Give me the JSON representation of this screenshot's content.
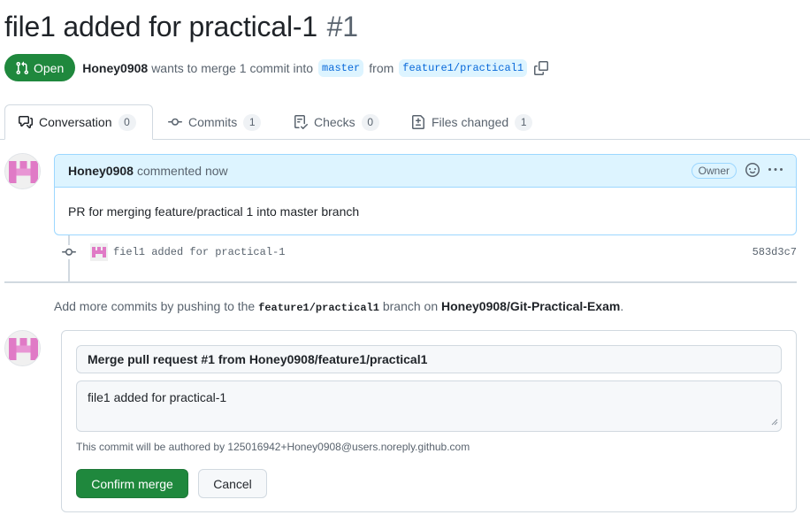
{
  "pr": {
    "title": "file1 added for practical-1",
    "number": "#1",
    "state_label": "Open",
    "author": "Honey0908",
    "merge_text_before": "wants to merge 1 commit into",
    "base_branch": "master",
    "merge_text_from": "from",
    "head_branch": "feature1/practical1"
  },
  "tabs": [
    {
      "label": "Conversation",
      "count": "0",
      "icon": "comment-discussion-icon"
    },
    {
      "label": "Commits",
      "count": "1",
      "icon": "git-commit-icon"
    },
    {
      "label": "Checks",
      "count": "0",
      "icon": "checklist-icon"
    },
    {
      "label": "Files changed",
      "count": "1",
      "icon": "file-diff-icon"
    }
  ],
  "comment": {
    "author": "Honey0908",
    "meta": "commented now",
    "role_badge": "Owner",
    "body": "PR for merging feature/practical 1 into master branch"
  },
  "commit": {
    "message": "fiel1 added for practical-1",
    "sha": "583d3c7"
  },
  "hint": {
    "prefix": "Add more commits by pushing to the",
    "branch": "feature1/practical1",
    "middle": "branch on",
    "repo": "Honey0908/Git-Practical-Exam",
    "suffix": "."
  },
  "merge": {
    "title_value": "Merge pull request #1 from Honey0908/feature1/practical1",
    "message_value": "file1 added for practical-1",
    "author_note": "This commit will be authored by 125016942+Honey0908@users.noreply.github.com",
    "confirm_label": "Confirm merge",
    "cancel_label": "Cancel"
  },
  "colors": {
    "open_green": "#1f883d",
    "link_blue": "#0969da",
    "header_blue": "#ddf4ff",
    "avatar_pink": "#e07ac6"
  }
}
